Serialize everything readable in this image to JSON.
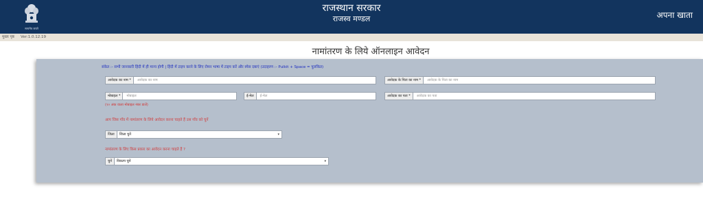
{
  "header": {
    "emblem_caption": "सत्यमेव जयते",
    "title": "राजस्थान सरकार",
    "subtitle": "राजस्व मण्डल",
    "account_link": "अपना खाता"
  },
  "subbar": {
    "home": "मुख्य पृष्ठ",
    "version": "Ver:1.0.12.19"
  },
  "page": {
    "title": "नामांतरण के लिये ऑनलाइन आवेदन"
  },
  "form": {
    "hint": "संकेत :- सभी जानकारी हिंदी में ही मान्य होगी | हिंदी में टाइप करने के लिए रोमन भाषा में टाइप करें और स्पेस दबाएं (उदाहरण :- Pulkit + Space = पुलकित)",
    "applicant_name": {
      "label": "आवेदक का नाम *",
      "placeholder": "आवेदक का नाम"
    },
    "father_name": {
      "label": "आवेदक के पिता का नाम *",
      "placeholder": "आवेदक के पिता का नाम"
    },
    "mobile": {
      "label": "मोबाइल *",
      "placeholder": "मोबाइल"
    },
    "mobile_error": "(१० अंक वाला मोबाइल नंबर डालें)",
    "email": {
      "label": "ई-मेल",
      "placeholder": "ई-मेल"
    },
    "address": {
      "label": "आवेदक का पता *",
      "placeholder": "आवेदक का पता"
    },
    "village_question": "आप जिस गाँव में नामांतरण के लिये आवेदन करना चाहते हैं उस गाँव को चुनें",
    "district": {
      "label": "जिला",
      "selected": "जिला चुनें"
    },
    "type_question": "नामांतरण के लिए किस प्रकार का आवेदन करना चाहते हैं ?",
    "choose": {
      "label": "चुनें",
      "selected": "विकल्प चुनें"
    }
  },
  "colors": {
    "header_bg": "#12345e",
    "panel_bg": "#b5bfcc",
    "hint_text": "#1a2bbf",
    "question_text": "#d13b3b"
  }
}
